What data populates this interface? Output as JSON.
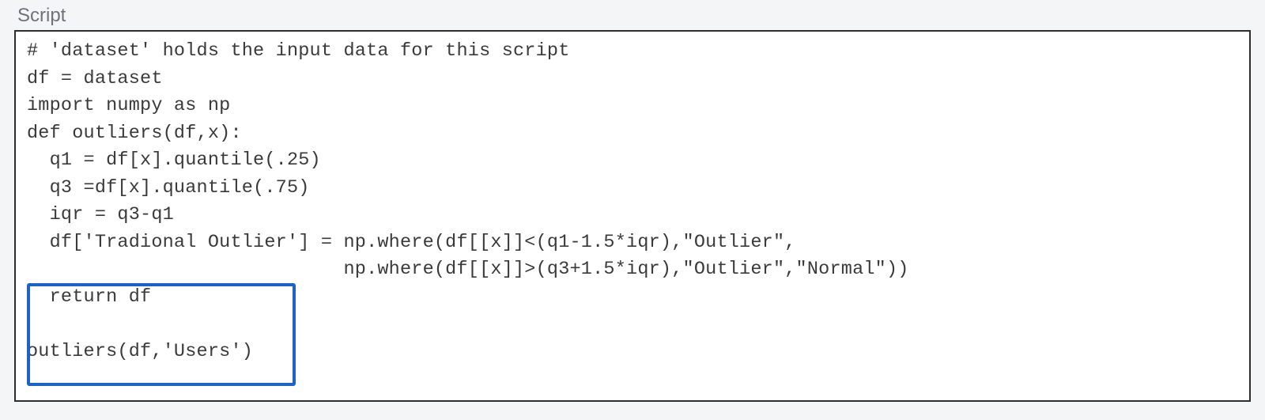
{
  "panel": {
    "label": "Script"
  },
  "editor": {
    "lines": [
      "# 'dataset' holds the input data for this script",
      "df = dataset",
      "import numpy as np",
      "def outliers(df,x):",
      "  q1 = df[x].quantile(.25)",
      "  q3 =df[x].quantile(.75)",
      "  iqr = q3-q1",
      "  df['Tradional Outlier'] = np.where(df[[x]]<(q1-1.5*iqr),\"Outlier\",",
      "                            np.where(df[[x]]>(q3+1.5*iqr),\"Outlier\",\"Normal\"))",
      "  return df",
      "",
      "outliers(df,'Users')"
    ]
  }
}
